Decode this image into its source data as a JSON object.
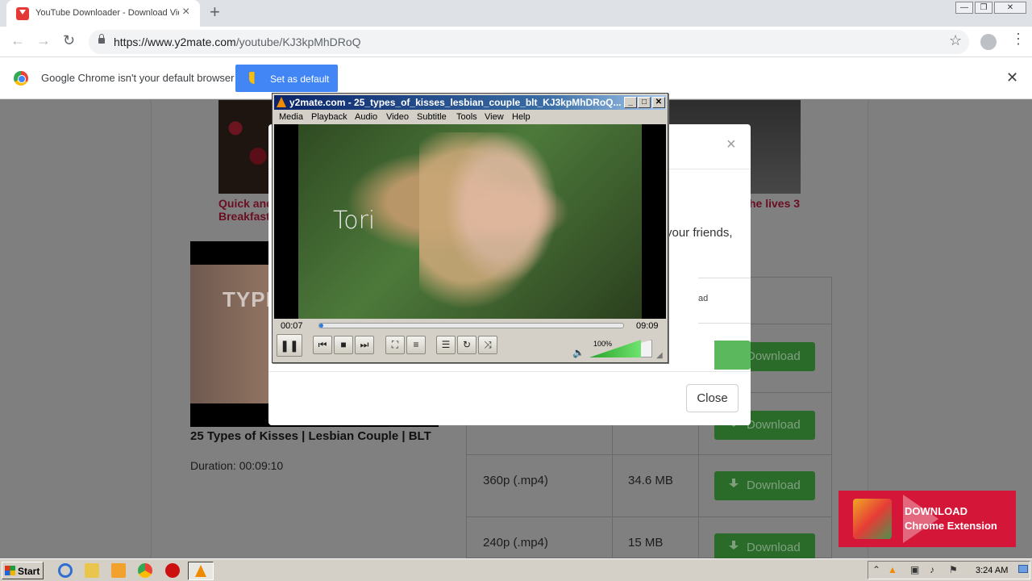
{
  "browser": {
    "tab_title": "YouTube Downloader - Download Vid",
    "url_host": "https://www.y2mate.com",
    "url_path": "/youtube/KJ3kpMhDRoQ"
  },
  "infobar": {
    "message": "Google Chrome isn't your default browser",
    "button": "Set as default"
  },
  "page": {
    "link_left_line1": "Quick and",
    "link_left_line2": "Breakfast",
    "link_right": "he lives 3",
    "thumb_text": "TYPE",
    "video_title": "25 Types of Kisses | Lesbian Couple | BLT",
    "duration": "Duration: 00:09:10",
    "rows": [
      {
        "quality": "360p (.mp4)",
        "size": "34.6 MB",
        "button": "Download"
      },
      {
        "quality": "240p (.mp4)",
        "size": "15 MB",
        "button": "Download"
      }
    ],
    "download_label": "Download"
  },
  "modal": {
    "text_fragment": "your friends,",
    "table_fragment": "ad",
    "download_fragment": "Download",
    "close_button": "Close"
  },
  "vlc": {
    "title": "y2mate.com - 25_types_of_kisses_lesbian_couple_blt_KJ3kpMhDRoQ...",
    "menus": [
      "Media",
      "Playback",
      "Audio",
      "Video",
      "Subtitle",
      "Tools",
      "View",
      "Help"
    ],
    "caption": "Tori",
    "time_elapsed": "00:07",
    "time_total": "09:09",
    "progress": 0.013,
    "volume_text": "100%",
    "volume": 1.0
  },
  "banner": {
    "line1": "DOWNLOAD",
    "line2": "Chrome Extension"
  },
  "taskbar": {
    "start": "Start",
    "clock": "3:24 AM"
  }
}
